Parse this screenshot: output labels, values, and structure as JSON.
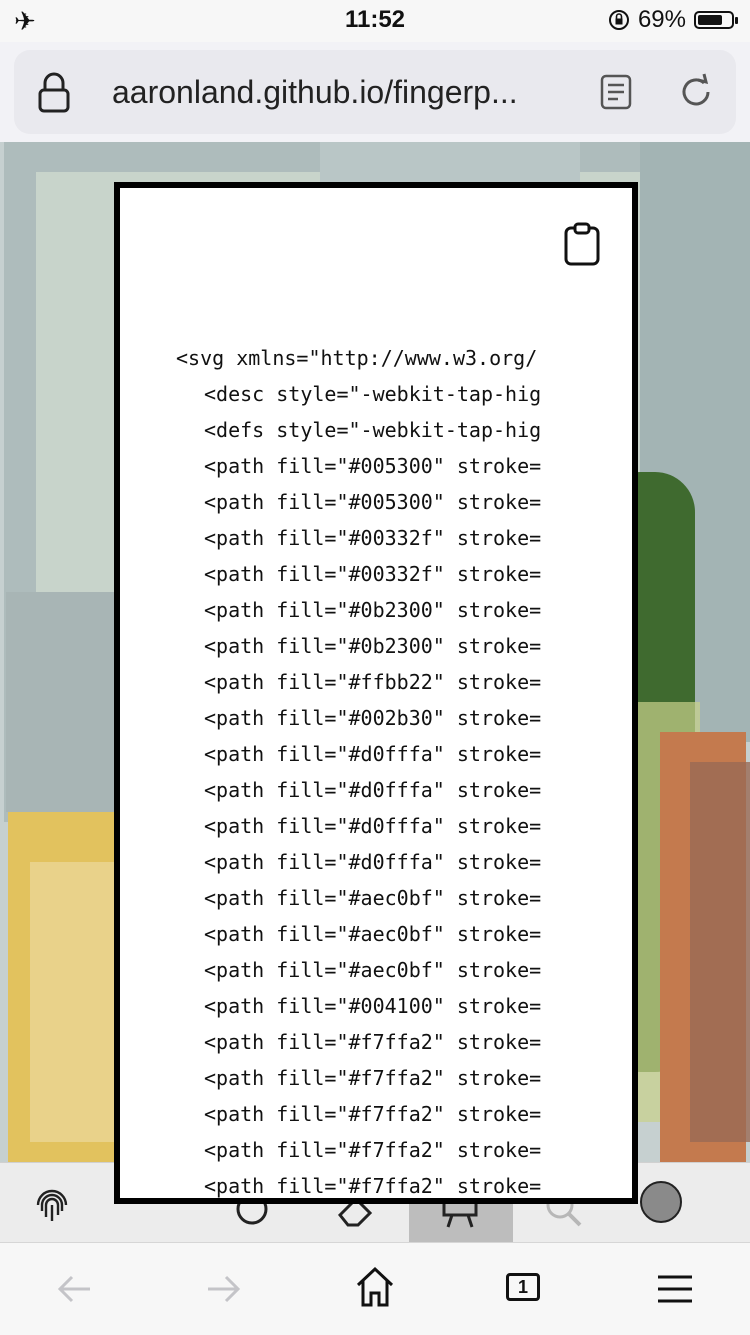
{
  "status": {
    "time": "11:52",
    "battery": "69%",
    "battery_level": 0.69
  },
  "browser": {
    "url": "aaronland.github.io/fingerp...",
    "tab_count": "1"
  },
  "code_lines": [
    "<svg xmlns=\"http://www.w3.org/",
    "<desc style=\"-webkit-tap-hig",
    "<defs style=\"-webkit-tap-hig",
    "<path fill=\"#005300\" stroke=",
    "<path fill=\"#005300\" stroke=",
    "<path fill=\"#00332f\" stroke=",
    "<path fill=\"#00332f\" stroke=",
    "<path fill=\"#0b2300\" stroke=",
    "<path fill=\"#0b2300\" stroke=",
    "<path fill=\"#ffbb22\" stroke=",
    "<path fill=\"#002b30\" stroke=",
    "<path fill=\"#d0fffa\" stroke=",
    "<path fill=\"#d0fffa\" stroke=",
    "<path fill=\"#d0fffa\" stroke=",
    "<path fill=\"#d0fffa\" stroke=",
    "<path fill=\"#aec0bf\" stroke=",
    "<path fill=\"#aec0bf\" stroke=",
    "<path fill=\"#aec0bf\" stroke=",
    "<path fill=\"#004100\" stroke=",
    "<path fill=\"#f7ffa2\" stroke=",
    "<path fill=\"#f7ffa2\" stroke=",
    "<path fill=\"#f7ffa2\" stroke=",
    "<path fill=\"#f7ffa2\" stroke=",
    "<path fill=\"#f7ffa2\" stroke="
  ],
  "toolbar": {
    "items": [
      "fingerprint-icon",
      "circle-tool-icon",
      "eraser-icon",
      "easel-icon",
      "zoom-icon",
      "color-swatch"
    ],
    "active": "easel-icon",
    "color_swatch": "#8a8a8a"
  },
  "colors": {
    "painting_bg": "#c6d0d0",
    "yellow": "#e2c25e",
    "green": "#3f6a2f",
    "orange": "#c47a4e"
  }
}
